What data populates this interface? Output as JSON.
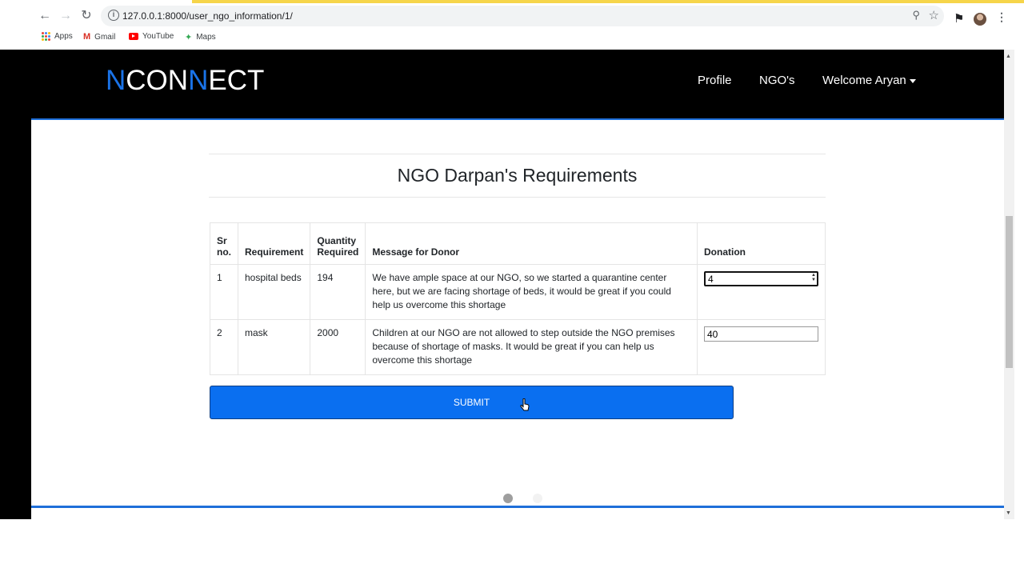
{
  "browser": {
    "url": "127.0.0.1:8000/user_ngo_information/1/",
    "bookmarks": [
      "Apps",
      "Gmail",
      "YouTube",
      "Maps"
    ]
  },
  "navbar": {
    "brand_n1": "N",
    "brand_con": "CON",
    "brand_n2": "N",
    "brand_ect": "ECT",
    "links": [
      "Profile",
      "NGO's",
      "Welcome Aryan"
    ]
  },
  "page": {
    "title": "NGO Darpan's Requirements",
    "table": {
      "headers": [
        "Sr no.",
        "Requirement",
        "Quantity Required",
        "Message for Donor",
        "Donation"
      ],
      "rows": [
        {
          "sr": "1",
          "requirement": "hospital beds",
          "quantity": "194",
          "message": "We have ample space at our NGO, so we started a quarantine center here, but we are facing shortage of beds, it would be great if you could help us overcome this shortage",
          "donation": "4"
        },
        {
          "sr": "2",
          "requirement": "mask",
          "quantity": "2000",
          "message": "Children at our NGO are not allowed to step outside the NGO premises because of shortage of masks. It would be great if you can help us overcome this shortage",
          "donation": "40"
        }
      ]
    },
    "submit_label": "SUBMIT"
  },
  "colors": {
    "accent_blue": "#1a73e8",
    "button_blue": "#0a6ff0",
    "navbar_bg": "#000000"
  }
}
